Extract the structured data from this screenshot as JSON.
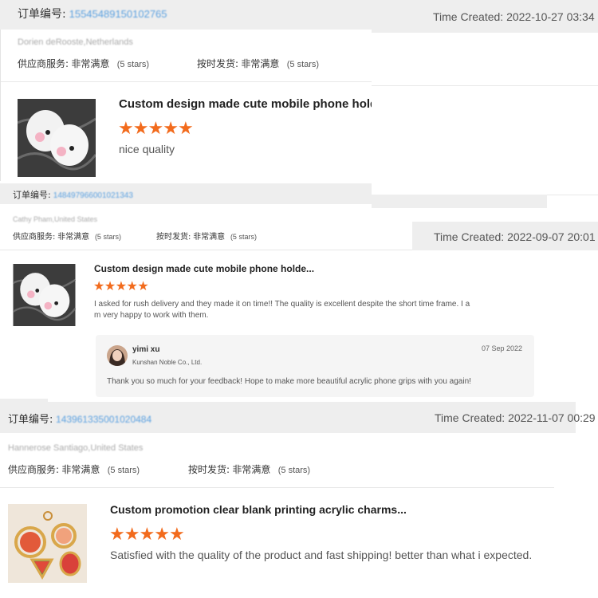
{
  "icons": {
    "star": "★",
    "thumb_image": "product-photo-icon",
    "avatar": "avatar-icon"
  },
  "colors": {
    "star": "#f26b1d",
    "order_id": "#5aa0e0",
    "header_bg": "#eeeeee"
  },
  "reviews": [
    {
      "order_label": "订单编号:",
      "order_id": "15545489150102765",
      "time_created": "Time Created: 2022-10-27 03:34",
      "location": "Dorien deRooste,Netherlands",
      "supplier_service_label": "供应商服务:",
      "supplier_service_value": "非常满意",
      "supplier_service_stars": "(5 stars)",
      "ontime_label": "按时发货:",
      "ontime_value": "非常满意",
      "ontime_stars": "(5 stars)",
      "product_title": "Custom design made cute mobile phone hold",
      "rating": 5,
      "review_text": "nice quality"
    },
    {
      "order_label": "订单编号:",
      "order_id": "148497966001021343",
      "time_created": "Time Created: 2022-09-07 20:01",
      "location": "Cathy Pham,United States",
      "supplier_service_label": "供应商服务:",
      "supplier_service_value": "非常满意",
      "supplier_service_stars": "(5 stars)",
      "ontime_label": "按时发货:",
      "ontime_value": "非常满意",
      "ontime_stars": "(5 stars)",
      "product_title": "Custom design made cute mobile phone holde...",
      "rating": 5,
      "review_text_line1": "I asked for rush delivery and they made it on time!! The quality is excellent despite the short time frame. I a",
      "review_text_line2": "m very happy to work with them.",
      "reply": {
        "name": "yimi xu",
        "company": "Kunshan Noble Co., Ltd.",
        "date": "07 Sep 2022",
        "text": "Thank you so much for your feedback! Hope to make more beautiful acrylic phone grips with you again!"
      }
    },
    {
      "order_label": "订单编号:",
      "order_id": "143961335001020484",
      "time_created": "Time Created: 2022-11-07 00:29",
      "location": "Hannerose Santiago,United States",
      "supplier_service_label": "供应商服务:",
      "supplier_service_value": "非常满意",
      "supplier_service_stars": "(5 stars)",
      "ontime_label": "按时发货:",
      "ontime_value": "非常满意",
      "ontime_stars": "(5 stars)",
      "product_title": "Custom promotion clear blank printing acrylic charms...",
      "rating": 5,
      "review_text": "Satisfied with the quality of the product and fast shipping! better than what i expected."
    }
  ]
}
